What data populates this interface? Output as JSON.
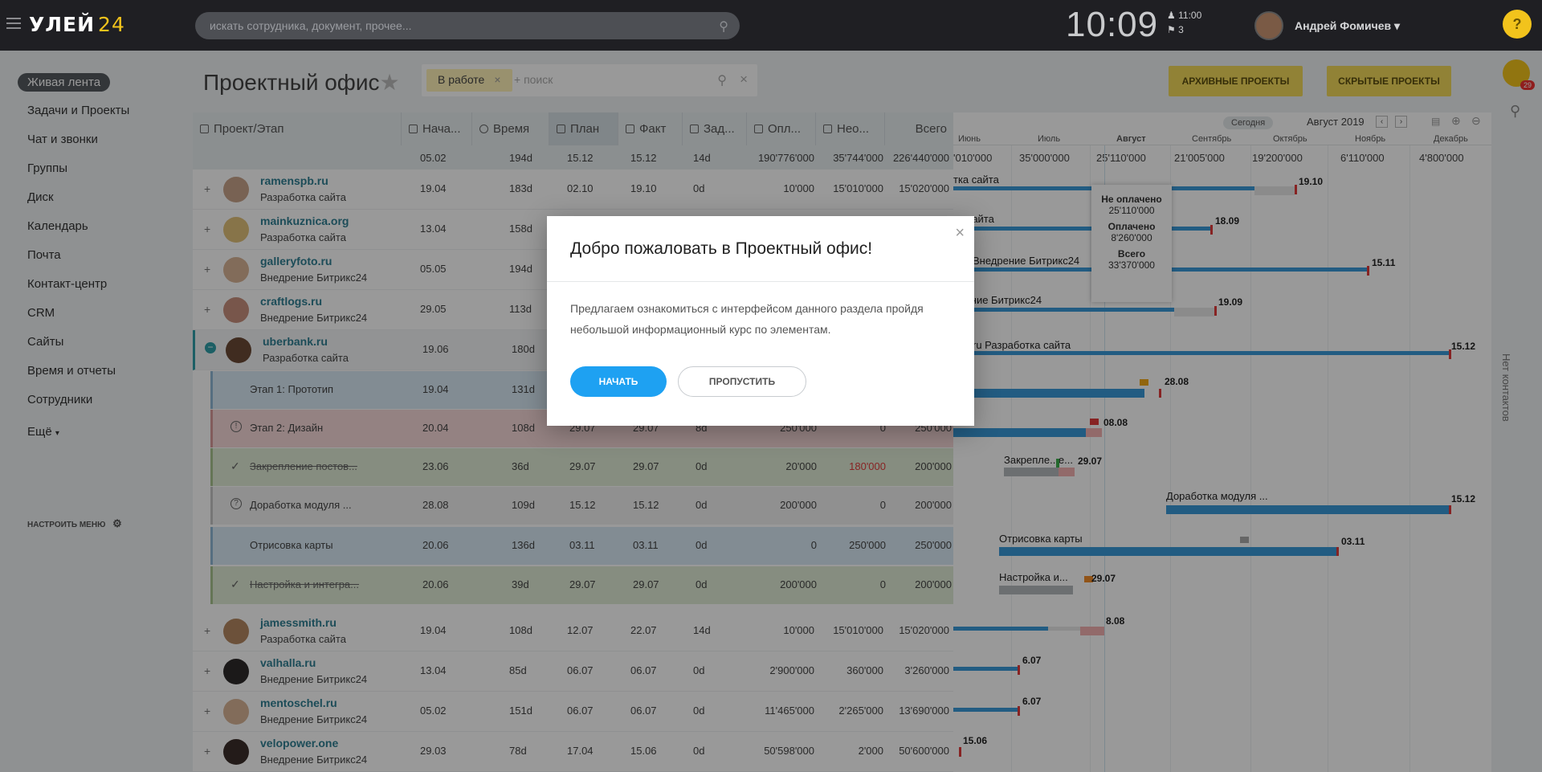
{
  "topbar": {
    "logo_text": "УЛЕЙ",
    "logo_num": "24",
    "search_placeholder": "искать сотрудника, документ, прочее...",
    "clock": "10:09",
    "alarm_time": "11:00",
    "flag_count": "3",
    "user_name": "Андрей Фомичев",
    "help": "?"
  },
  "sidebar": {
    "items": [
      "Живая лента",
      "Задачи и Проекты",
      "Чат и звонки",
      "Группы",
      "Диск",
      "Календарь",
      "Почта",
      "Контакт-центр",
      "CRM",
      "Сайты",
      "Время и отчеты",
      "Сотрудники",
      "Ещё"
    ],
    "configure": "НАСТРОИТЬ МЕНЮ"
  },
  "page": {
    "title": "Проектный офис",
    "filter_chip": "В работе",
    "filter_placeholder": "+ поиск",
    "archive_btn": "АРХИВНЫЕ ПРОЕКТЫ",
    "hidden_btn": "СКРЫТЫЕ ПРОЕКТЫ"
  },
  "right": {
    "badge_count": "29",
    "no_contacts": "Нет контактов"
  },
  "table": {
    "headers": [
      "Проект/Этап",
      "Нача...",
      "Время",
      "План",
      "Факт",
      "Зад...",
      "Опл...",
      "Нео...",
      "Всего"
    ],
    "totals": [
      "05.02",
      "194d",
      "15.12",
      "15.12",
      "14d",
      "190'776'000",
      "35'744'000",
      "226'440'000"
    ],
    "projects": [
      {
        "title": "ramenspb.ru",
        "sub": "Разработка сайта",
        "vals": [
          "19.04",
          "183d",
          "02.10",
          "19.10",
          "0d",
          "10'000",
          "15'010'000",
          "15'020'000"
        ]
      },
      {
        "title": "mainkuznica.org",
        "sub": "Разработка сайта",
        "vals": [
          "13.04",
          "158d",
          "",
          "",
          "",
          "",
          "",
          ""
        ]
      },
      {
        "title": "galleryfoto.ru",
        "sub": "Внедрение Битрикс24",
        "vals": [
          "05.05",
          "194d",
          "",
          "",
          "",
          "",
          "",
          ""
        ]
      },
      {
        "title": "craftlogs.ru",
        "sub": "Внедрение Битрикс24",
        "vals": [
          "29.05",
          "113d",
          "",
          "",
          "",
          "",
          "",
          ""
        ]
      },
      {
        "title": "uberbank.ru",
        "sub": "Разработка сайта",
        "vals": [
          "19.06",
          "180d",
          "",
          "",
          "",
          "",
          "",
          ""
        ]
      }
    ],
    "stages": [
      {
        "name": "Этап 1: Прототип",
        "icon": "",
        "vals": [
          "19.04",
          "131d",
          "",
          "",
          "",
          "",
          "",
          ""
        ]
      },
      {
        "name": "Этап 2: Дизайн",
        "icon": "!",
        "vals": [
          "20.04",
          "108d",
          "29.07",
          "29.07",
          "8d",
          "250'000",
          "0",
          "250'000"
        ]
      },
      {
        "name": "Закрепление постов...",
        "icon": "✓",
        "vals": [
          "23.06",
          "36d",
          "29.07",
          "29.07",
          "0d",
          "20'000",
          "180'000",
          "200'000"
        ]
      },
      {
        "name": "Доработка модуля ...",
        "icon": "?",
        "vals": [
          "28.08",
          "109d",
          "15.12",
          "15.12",
          "0d",
          "200'000",
          "0",
          "200'000"
        ]
      },
      {
        "name": "Отрисовка карты",
        "icon": "",
        "vals": [
          "20.06",
          "136d",
          "03.11",
          "03.11",
          "0d",
          "0",
          "250'000",
          "250'000"
        ]
      },
      {
        "name": "Настройка и интегра...",
        "icon": "✓",
        "vals": [
          "20.06",
          "39d",
          "29.07",
          "29.07",
          "0d",
          "200'000",
          "0",
          "200'000"
        ]
      }
    ],
    "projects2": [
      {
        "title": "jamessmith.ru",
        "sub": "Разработка сайта",
        "vals": [
          "19.04",
          "108d",
          "12.07",
          "22.07",
          "14d",
          "10'000",
          "15'010'000",
          "15'020'000"
        ]
      },
      {
        "title": "valhalla.ru",
        "sub": "Внедрение Битрикс24",
        "vals": [
          "13.04",
          "85d",
          "06.07",
          "06.07",
          "0d",
          "2'900'000",
          "360'000",
          "3'260'000"
        ]
      },
      {
        "title": "mentoschel.ru",
        "sub": "Внедрение Битрикс24",
        "vals": [
          "05.02",
          "151d",
          "06.07",
          "06.07",
          "0d",
          "11'465'000",
          "2'265'000",
          "13'690'000"
        ]
      },
      {
        "title": "velopower.one",
        "sub": "Внедрение Битрикс24",
        "vals": [
          "29.03",
          "78d",
          "17.04",
          "15.06",
          "0d",
          "50'598'000",
          "2'000",
          "50'600'000"
        ]
      }
    ]
  },
  "gantt": {
    "today": "Сегодня",
    "current": "Август 2019",
    "months": [
      "Июнь",
      "Июль",
      "Август",
      "Сентябрь",
      "Октябрь",
      "Ноябрь",
      "Декабрь"
    ],
    "month_totals": [
      "'010'000",
      "35'000'000",
      "25'110'000",
      "21'005'000",
      "19'200'000",
      "6'110'000",
      "4'800'000"
    ],
    "labels": [
      "тка сайта",
      "ка сайта",
      "Внедрение Битрикс24",
      "едение Битрикс24",
      "ru Разработка сайта",
      "Закрепле...е...",
      "Доработка модуля ...",
      "Отрисовка карты",
      "Настройка и..."
    ],
    "dates": [
      "19.10",
      "18.09",
      "15.11",
      "19.09",
      "15.12",
      "28.08",
      "08.08",
      "29.07",
      "15.12",
      "03.11",
      "29.07",
      "8.08",
      "6.07",
      "6.07",
      "15.06"
    ],
    "tooltip": {
      "unpaid_label": "Не оплачено",
      "unpaid": "25'110'000",
      "paid_label": "Оплачено",
      "paid": "8'260'000",
      "total_label": "Всего",
      "total": "33'370'000"
    }
  },
  "modal": {
    "title": "Добро пожаловать в Проектный офис!",
    "text": "Предлагаем ознакомиться с интерфейсом данного раздела пройдя небольшой  информационный курс по элементам.",
    "start": "НАЧАТЬ",
    "skip": "ПРОПУСТИТЬ",
    "close": "×"
  }
}
